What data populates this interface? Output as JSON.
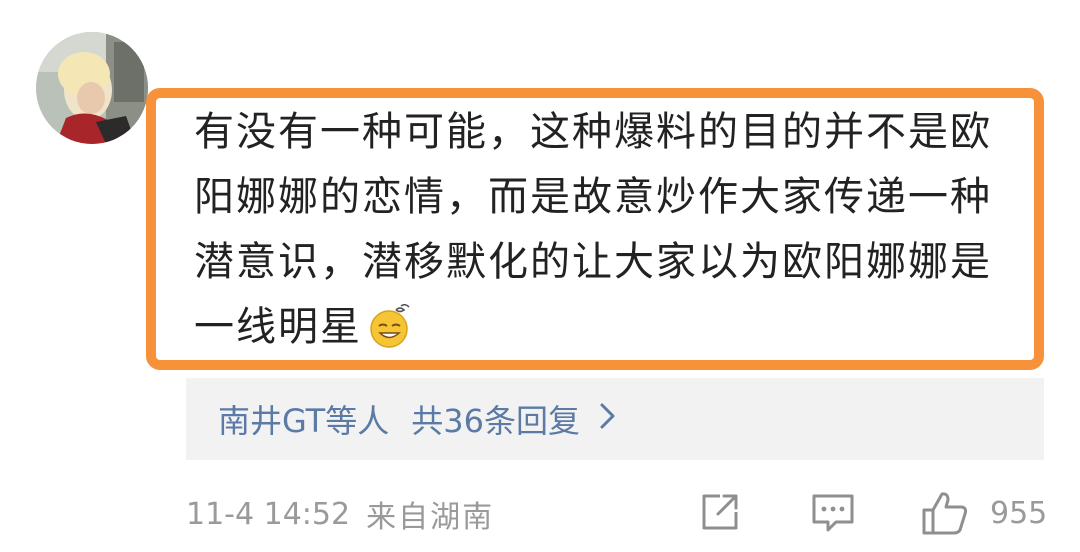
{
  "comment": {
    "lines": [
      "有没有一种可能，这种爆料的目的并不是欧",
      "阳娜娜的恋情，而是故意炒作大家传递一种",
      "潜意识，潜移默化的让大家以为欧阳娜娜是",
      "一线明星"
    ],
    "emoji": "sweat-smile-emoji"
  },
  "replies": {
    "who": "南井GT等人",
    "count_label": "共36条回复",
    "chevron": "chevron-right-icon"
  },
  "footer": {
    "time": "11-4 14:52",
    "source": "来自湖南",
    "like_count": "955",
    "icons": [
      "share-icon",
      "comment-icon",
      "like-icon"
    ]
  },
  "colors": {
    "highlight_border": "#f7923a",
    "link": "#5b7aa5",
    "meta": "#9a9a9a",
    "reply_bg": "#f2f2f2"
  }
}
